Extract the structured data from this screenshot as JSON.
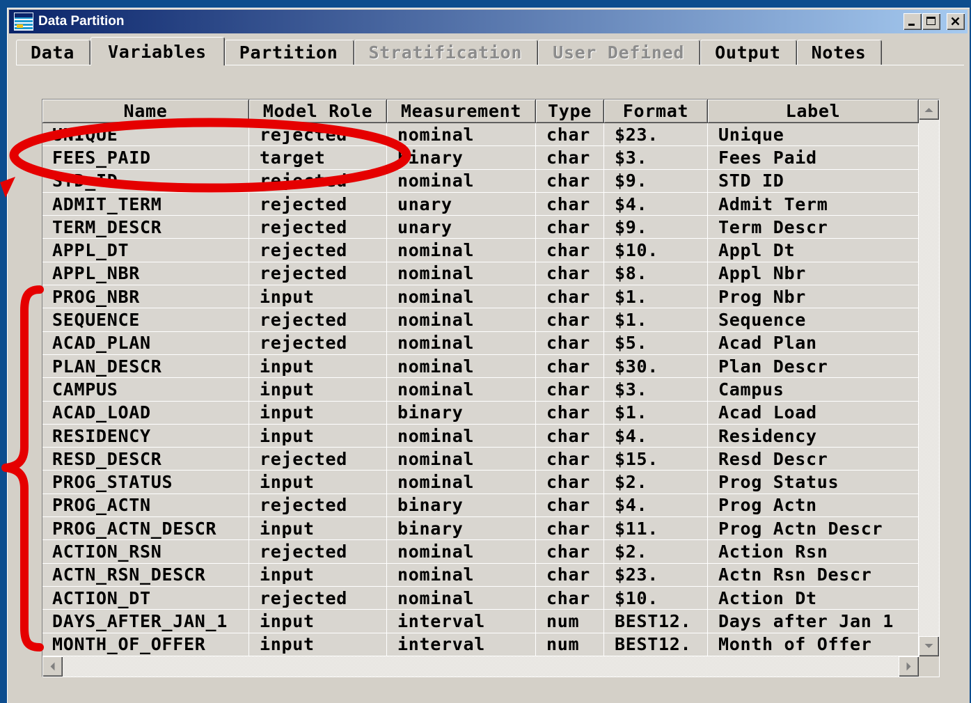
{
  "window": {
    "title": "Data Partition"
  },
  "icons": {
    "app": "sas-app-icon",
    "minimize": "minimize-icon",
    "maximize": "maximize-icon",
    "close": "close-icon",
    "scroll_up": "scroll-up-icon",
    "scroll_down": "scroll-down-icon",
    "scroll_left": "scroll-left-icon",
    "scroll_right": "scroll-right-icon"
  },
  "tabs": [
    {
      "label": "Data",
      "selected": false,
      "disabled": false
    },
    {
      "label": "Variables",
      "selected": true,
      "disabled": false
    },
    {
      "label": "Partition",
      "selected": false,
      "disabled": false
    },
    {
      "label": "Stratification",
      "selected": false,
      "disabled": true
    },
    {
      "label": "User Defined",
      "selected": false,
      "disabled": true
    },
    {
      "label": "Output",
      "selected": false,
      "disabled": false
    },
    {
      "label": "Notes",
      "selected": false,
      "disabled": false
    }
  ],
  "table": {
    "columns": [
      "Name",
      "Model Role",
      "Measurement",
      "Type",
      "Format",
      "Label"
    ],
    "rows": [
      [
        "UNIQUE",
        "rejected",
        "nominal",
        "char",
        "$23.",
        "Unique"
      ],
      [
        "FEES_PAID",
        "target",
        "binary",
        "char",
        "$3.",
        "Fees Paid"
      ],
      [
        "STD_ID",
        "rejected",
        "nominal",
        "char",
        "$9.",
        "STD ID"
      ],
      [
        "ADMIT_TERM",
        "rejected",
        "unary",
        "char",
        "$4.",
        "Admit Term"
      ],
      [
        "TERM_DESCR",
        "rejected",
        "unary",
        "char",
        "$9.",
        "Term Descr"
      ],
      [
        "APPL_DT",
        "rejected",
        "nominal",
        "char",
        "$10.",
        "Appl Dt"
      ],
      [
        "APPL_NBR",
        "rejected",
        "nominal",
        "char",
        "$8.",
        "Appl Nbr"
      ],
      [
        "PROG_NBR",
        "input",
        "nominal",
        "char",
        "$1.",
        "Prog Nbr"
      ],
      [
        "SEQUENCE",
        "rejected",
        "nominal",
        "char",
        "$1.",
        "Sequence"
      ],
      [
        "ACAD_PLAN",
        "rejected",
        "nominal",
        "char",
        "$5.",
        "Acad Plan"
      ],
      [
        "PLAN_DESCR",
        "input",
        "nominal",
        "char",
        "$30.",
        "Plan Descr"
      ],
      [
        "CAMPUS",
        "input",
        "nominal",
        "char",
        "$3.",
        "Campus"
      ],
      [
        "ACAD_LOAD",
        "input",
        "binary",
        "char",
        "$1.",
        "Acad Load"
      ],
      [
        "RESIDENCY",
        "input",
        "nominal",
        "char",
        "$4.",
        "Residency"
      ],
      [
        "RESD_DESCR",
        "rejected",
        "nominal",
        "char",
        "$15.",
        "Resd Descr"
      ],
      [
        "PROG_STATUS",
        "input",
        "nominal",
        "char",
        "$2.",
        "Prog Status"
      ],
      [
        "PROG_ACTN",
        "rejected",
        "binary",
        "char",
        "$4.",
        "Prog Actn"
      ],
      [
        "PROG_ACTN_DESCR",
        "input",
        "binary",
        "char",
        "$11.",
        "Prog Actn Descr"
      ],
      [
        "ACTION_RSN",
        "rejected",
        "nominal",
        "char",
        "$2.",
        "Action Rsn"
      ],
      [
        "ACTN_RSN_DESCR",
        "input",
        "nominal",
        "char",
        "$23.",
        "Actn Rsn Descr"
      ],
      [
        "ACTION_DT",
        "rejected",
        "nominal",
        "char",
        "$10.",
        "Action Dt"
      ],
      [
        "DAYS_AFTER_JAN_1",
        "input",
        "interval",
        "num",
        "BEST12.",
        "Days after Jan 1"
      ],
      [
        "MONTH_OF_OFFER",
        "input",
        "interval",
        "num",
        "BEST12.",
        "Month of Offer"
      ]
    ]
  },
  "colors": {
    "slide_background": "#0d4d8e",
    "window_face": "#d4d0c8",
    "title_start": "#0a246a",
    "title_end": "#a6caf0",
    "title_text": "#ffffff",
    "cell_background": "#d9d6d0",
    "grid_line": "#ffffff",
    "text": "#000000",
    "disabled_text": "#8c8c8c",
    "annotation": "#e50000"
  }
}
